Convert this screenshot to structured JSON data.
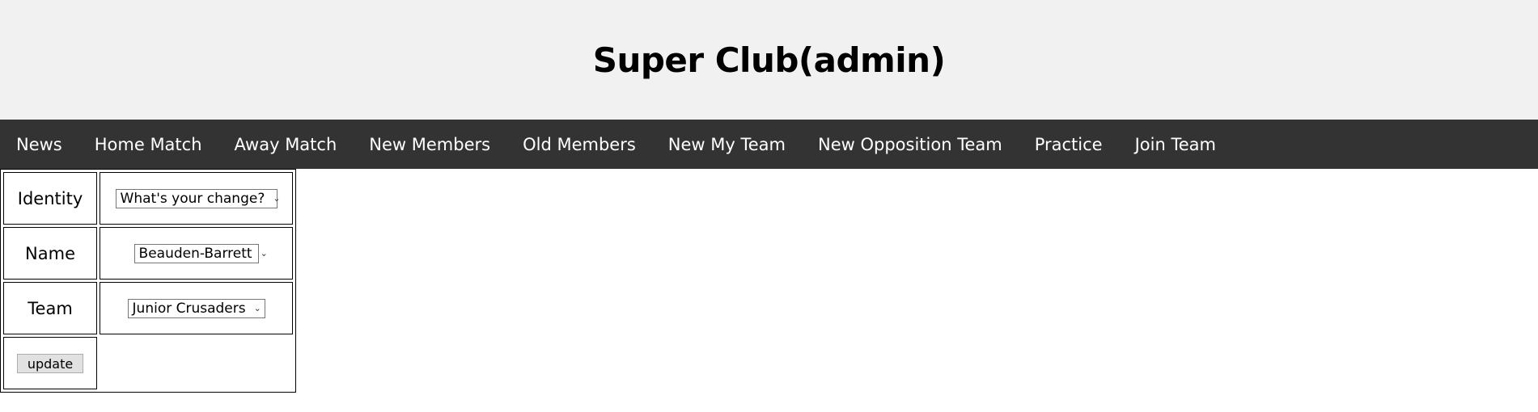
{
  "header": {
    "title": "Super Club(admin)"
  },
  "nav": {
    "items": [
      {
        "label": "News"
      },
      {
        "label": "Home Match"
      },
      {
        "label": "Away Match"
      },
      {
        "label": "New Members"
      },
      {
        "label": "Old Members"
      },
      {
        "label": "New My Team"
      },
      {
        "label": "New Opposition Team"
      },
      {
        "label": "Practice"
      },
      {
        "label": "Join Team"
      }
    ]
  },
  "form": {
    "identity": {
      "label": "Identity",
      "selected": "What's your change?"
    },
    "name": {
      "label": "Name",
      "selected": "Beauden-Barrett"
    },
    "team": {
      "label": "Team",
      "selected": "Junior Crusaders"
    },
    "update_label": "update"
  },
  "colors": {
    "header_bg": "#f1f1f1",
    "nav_bg": "#333333",
    "nav_text": "#ffffff"
  }
}
